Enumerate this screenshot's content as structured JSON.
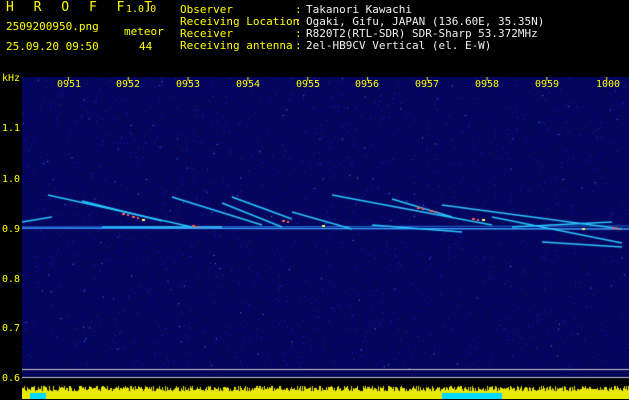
{
  "header": {
    "app_name": "H R O F F T",
    "version": "1.0.0",
    "file_name": "2509200950.png",
    "timestamp": "25.09.20 09:50",
    "meteor_label": "meteor",
    "meteor_count": "44"
  },
  "station": [
    {
      "label": "Observer",
      "value": "Takanori Kawachi"
    },
    {
      "label": "Receiving Location",
      "value": "Ogaki, Gifu, JAPAN (136.60E, 35.35N)"
    },
    {
      "label": "Receiver",
      "value": "R820T2(RTL-SDR) SDR-Sharp 53.372MHz"
    },
    {
      "label": "Receiving antenna",
      "value": "2el-HB9CV Vertical (el. E-W)"
    }
  ],
  "colon": ":",
  "axis": {
    "y_unit": "kHz",
    "y_ticks": [
      "1.1",
      "1.0",
      "0.9",
      "0.8",
      "0.7",
      "0.6"
    ],
    "x_ticks": [
      "0951",
      "0952",
      "0953",
      "0954",
      "0955",
      "0956",
      "0957",
      "0958",
      "0959",
      "1000"
    ]
  },
  "colors": {
    "label": "#ffff00",
    "background": "#000000",
    "noise_floor": "#0a0a7a",
    "meteor_trail": "#33ccff",
    "meteor_hot": "#ff6060",
    "baseline_bar": "#ffff00",
    "baseline_cyan": "#00e5ff"
  }
}
